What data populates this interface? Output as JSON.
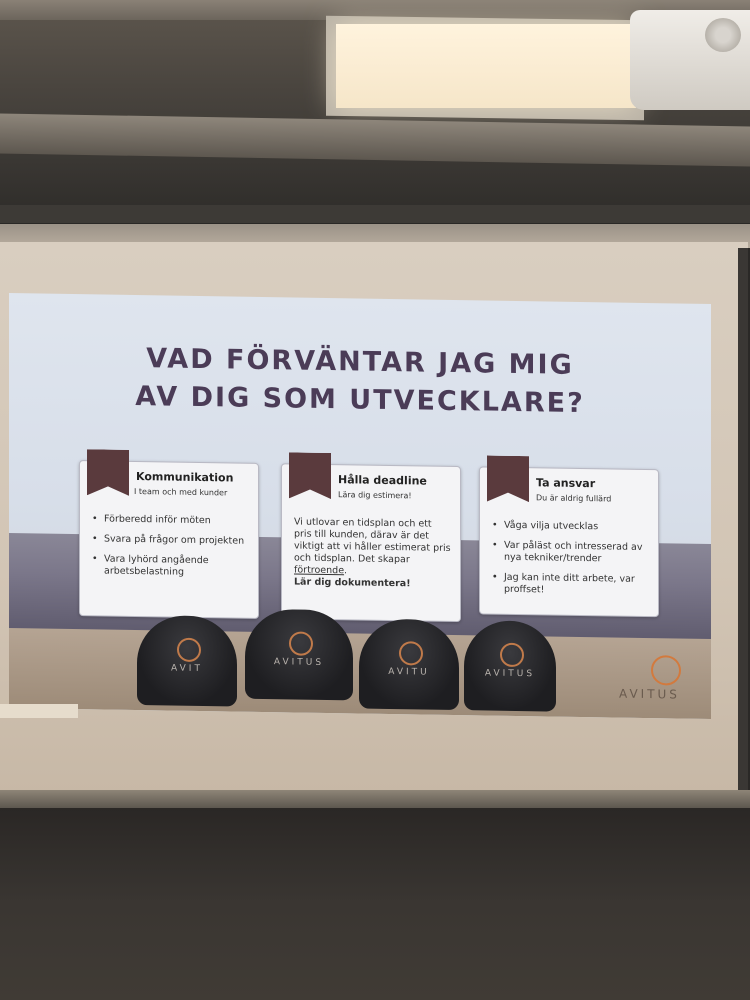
{
  "slide": {
    "title_line1": "VAD FÖRVÄNTAR JAG MIG",
    "title_line2": "AV DIG SOM UTVECKLARE?",
    "cards": [
      {
        "title": "Kommunikation",
        "subtitle": "I team och med kunder",
        "items": [
          "Förberedd inför möten",
          "Svara på frågor om projekten",
          "Vara lyhörd angående arbetsbelastning"
        ]
      },
      {
        "title": "Hålla deadline",
        "subtitle": "Lära dig estimera!",
        "body": "Vi utlovar en tidsplan och ett pris till kunden, därav är det viktigt att vi håller estimerat pris och tidsplan. Det skapar",
        "body_underlined": "förtroende",
        "body_bold": "Lär dig dokumentera!"
      },
      {
        "title": "Ta ansvar",
        "subtitle": "Du är aldrig fullärd",
        "items": [
          "Våga vilja utvecklas",
          "Var påläst och intresserad av nya tekniker/trender",
          "",
          "Jag kan inte ditt arbete, var proffset!"
        ]
      }
    ],
    "brand": "AVITUS",
    "cap_labels": [
      "AVIT",
      "AVITUS",
      "AVITU",
      "AVITUS"
    ]
  },
  "colors": {
    "title": "#4b3c57",
    "ribbon": "#5a3a3d",
    "logo_orange": "#d27a3e"
  }
}
